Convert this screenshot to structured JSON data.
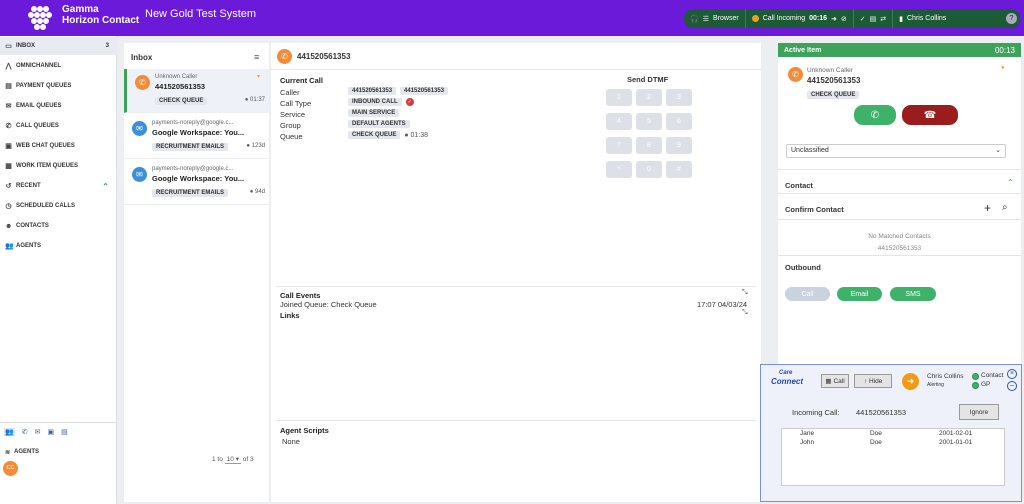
{
  "header": {
    "brand_line1": "Gamma",
    "brand_line2": "Horizon Contact",
    "system_name": "New Gold Test System",
    "browser_label": "Browser",
    "call_status": "Call Incoming",
    "call_timer": "00:16",
    "user_name": "Chris Collins"
  },
  "sidebar": {
    "items": [
      {
        "label": "INBOX",
        "badge": "3"
      },
      {
        "label": "OMNICHANNEL"
      },
      {
        "label": "PAYMENT QUEUES"
      },
      {
        "label": "EMAIL QUEUES"
      },
      {
        "label": "CALL QUEUES"
      },
      {
        "label": "WEB CHAT QUEUES"
      },
      {
        "label": "WORK ITEM QUEUES"
      },
      {
        "label": "RECENT"
      },
      {
        "label": "SCHEDULED CALLS"
      },
      {
        "label": "CONTACTS"
      },
      {
        "label": "AGENTS"
      }
    ],
    "bottom_label": "AGENTS",
    "avatar_initials": "CC"
  },
  "inbox": {
    "title": "Inbox",
    "cards": [
      {
        "line1": "Unknown Caller",
        "line2": "441520561353",
        "tag": "CHECK QUEUE",
        "age": "01:37"
      },
      {
        "line1": "payments-noreply@google.c...",
        "line2": "Google Workspace: You...",
        "tag": "RECRUITMENT EMAILS",
        "age": "123d"
      },
      {
        "line1": "payments-noreply@google.c...",
        "line2": "Google Workspace: You...",
        "tag": "RECRUITMENT EMAILS",
        "age": "94d"
      }
    ],
    "pager": {
      "from": "1 to",
      "size": "10",
      "of": "of 3"
    }
  },
  "main": {
    "header_number": "441520561353",
    "current_call_title": "Current Call",
    "fields": [
      {
        "label": "Caller",
        "values": [
          "441520561353",
          "441520561353"
        ]
      },
      {
        "label": "Call Type",
        "values": [
          "INBOUND CALL"
        ]
      },
      {
        "label": "Service",
        "values": [
          "MAIN SERVICE"
        ]
      },
      {
        "label": "Group",
        "values": [
          "DEFAULT AGENTS"
        ]
      },
      {
        "label": "Queue",
        "values": [
          "CHECK QUEUE"
        ],
        "extra": "01:38"
      }
    ],
    "dtmf_title": "Send DTMF",
    "dtmf_keys": [
      "1",
      "2",
      "3",
      "4",
      "5",
      "6",
      "7",
      "8",
      "9",
      "*",
      "0",
      "#"
    ],
    "call_events_title": "Call Events",
    "event_text": "Joined Queue: Check Queue",
    "event_time": "17:07 04/03/24",
    "links_title": "Links",
    "scripts_title": "Agent Scripts",
    "scripts_value": "None"
  },
  "active_item": {
    "title": "Active Item",
    "timer": "00:13",
    "caller": "Unknown Caller",
    "number": "441520561353",
    "tag": "CHECK QUEUE",
    "disposition": "Unclassified",
    "contact_title": "Contact",
    "confirm_title": "Confirm Contact",
    "no_match": "No Matched Contacts",
    "no_match_number": "441520561353",
    "outbound_title": "Outbound",
    "outbound_buttons": [
      "Call",
      "Email",
      "SMS"
    ]
  },
  "popup": {
    "logo_line1": "Care",
    "logo_line2": "Connect",
    "call_btn": "Call",
    "hide_btn": "Hide",
    "agent_name": "Chris Collins",
    "agent_state": "Alerting",
    "status1": "Contact",
    "status2": "GP",
    "incoming_label": "Incoming Call:",
    "incoming_number": "441520561353",
    "ignore_btn": "Ignore",
    "rows": [
      {
        "first": "Jane",
        "last": "Doe",
        "dob": "2001-02-01"
      },
      {
        "first": "John",
        "last": "Doe",
        "dob": "2001-01-01"
      }
    ]
  }
}
